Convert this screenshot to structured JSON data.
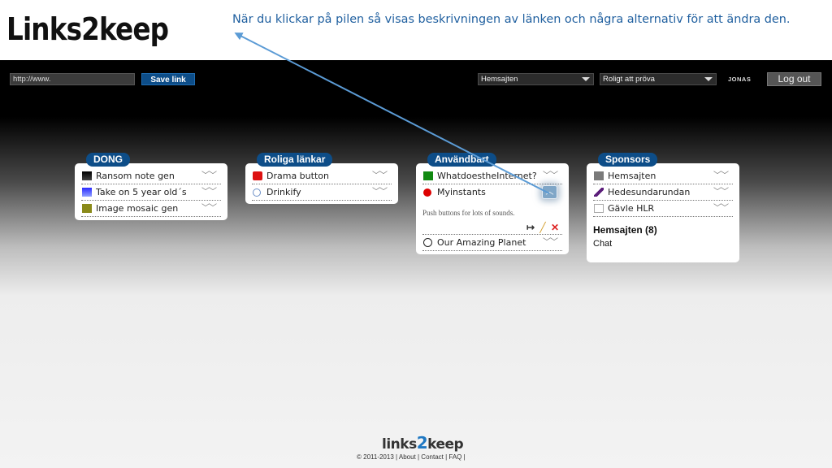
{
  "slide": {
    "title": "Links2keep",
    "caption": "När du klickar på pilen så visas beskrivningen av länken och några alternativ för att ändra den."
  },
  "topbar": {
    "url_value": "http://www.",
    "save_label": "Save link",
    "dropdown1": "Hemsajten",
    "dropdown2": "Roligt att pröva",
    "user": "JONAS",
    "logout_label": "Log out"
  },
  "categories": [
    {
      "name": "DONG",
      "links": [
        {
          "label": "Ransom note gen",
          "icon": "black-square-icon"
        },
        {
          "label": "Take on 5 year old´s",
          "icon": "blue-gradient-icon"
        },
        {
          "label": "Image mosaic gen",
          "icon": "olive-square-icon"
        }
      ]
    },
    {
      "name": "Roliga länkar",
      "links": [
        {
          "label": "Drama button",
          "icon": "youtube-icon"
        },
        {
          "label": "Drinkify",
          "icon": "circle-icon"
        }
      ]
    },
    {
      "name": "Användbart",
      "links": [
        {
          "label": "WhatdoestheInternet?",
          "icon": "green-square-icon"
        },
        {
          "label": "Myinstants",
          "icon": "red-dot-icon"
        },
        {
          "label": "Our Amazing Planet",
          "icon": "info-circle-icon"
        }
      ],
      "expanded": {
        "description": "Push buttons for lots of sounds."
      }
    },
    {
      "name": "Sponsors",
      "links": [
        {
          "label": "Hemsajten",
          "icon": "hourglass-icon"
        },
        {
          "label": "Hedesundarundan",
          "icon": "pin-icon"
        },
        {
          "label": "Gävle HLR",
          "icon": "empty-square-icon"
        }
      ],
      "info_title": "Hemsajten (8)",
      "info_sub": "Chat"
    }
  ],
  "footer": {
    "logo_a": "links",
    "logo_b": "2",
    "logo_c": "keep",
    "text": "© 2011-2013 | About | Contact | FAQ |"
  },
  "colors": {
    "accent": "#0d4d88",
    "caption": "#1f5f9f",
    "arrow": "#5b9bd5"
  }
}
